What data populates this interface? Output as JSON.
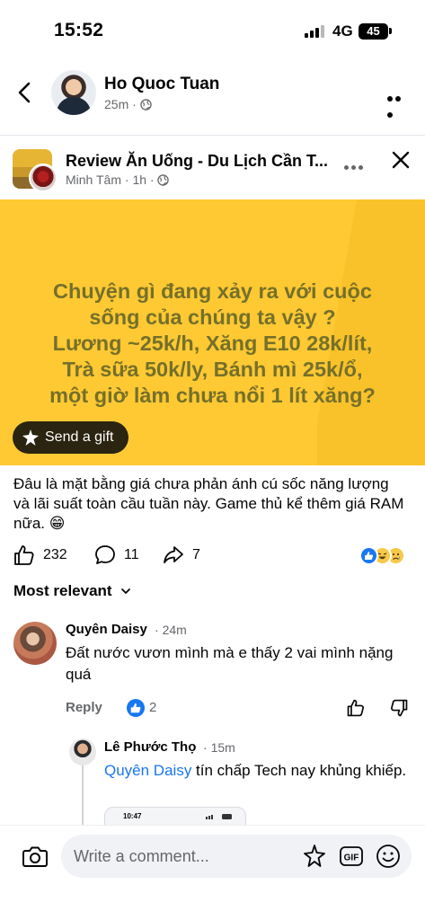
{
  "status_bar": {
    "time": "15:52",
    "network": "4G",
    "battery": "45"
  },
  "header": {
    "author_name": "Ho Quoc Tuan",
    "timestamp": "25m",
    "audience_icon": "globe-icon"
  },
  "shared_post": {
    "group_name": "Review Ăn Uống - Du Lịch Cần T...",
    "member_name": "Minh Tâm",
    "timestamp": "1h",
    "audience_icon": "globe-icon",
    "image_text_lines": [
      "Chuyện gì đang xảy ra với cuộc",
      "sống của chúng ta vậy ?",
      "Lương ~25k/h, Xăng E10 28k/lít,",
      "Trà sữa 50k/ly, Bánh mì 25k/ổ,",
      "một giờ làm chưa nổi 1 lít xăng?"
    ],
    "gift_label": "Send a gift",
    "image_bg_color": "#ffc933"
  },
  "caption": "Đâu là mặt bằng giá chưa phản ánh cú sốc năng lượng và lãi suất toàn cầu tuần này. Game thủ kể thêm giá RAM nữa. 😁",
  "reactions": {
    "like_count": "232",
    "comment_count": "11",
    "share_count": "7",
    "reaction_types": [
      "like",
      "haha",
      "sad"
    ]
  },
  "comments_section": {
    "sort_label": "Most relevant",
    "comments": [
      {
        "author": "Quyên Daisy",
        "time": "24m",
        "text": "Đất nước vươn mình mà e thấy 2 vai mình nặng quá",
        "reply_label": "Reply",
        "like_count": "2"
      }
    ],
    "reply": {
      "author": "Lê Phước Thọ",
      "time": "15m",
      "mention": "Quyên Daisy",
      "text": " tín chấp Tech nay khủng khiếp.",
      "image_time": "10:47"
    }
  },
  "composer": {
    "placeholder": "Write a comment..."
  },
  "colors": {
    "accent": "#1877f2",
    "muted_text": "#65676b",
    "image_text": "#75702a"
  }
}
